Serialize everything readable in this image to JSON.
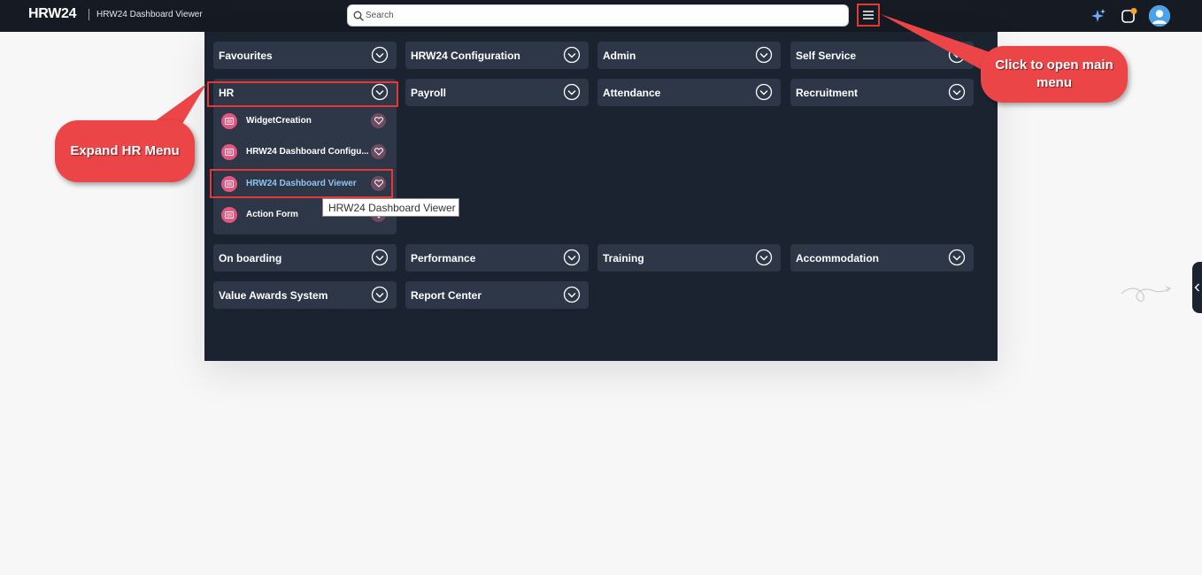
{
  "header": {
    "logo": "HRW24",
    "page_title": "HRW24 Dashboard Viewer",
    "search_placeholder": "Search"
  },
  "menu": {
    "rows": [
      [
        {
          "label": "Favourites"
        },
        {
          "label": "HRW24 Configuration"
        },
        {
          "label": "Admin"
        },
        {
          "label": "Self Service"
        }
      ],
      [
        {
          "label": "HR"
        },
        {
          "label": "Payroll"
        },
        {
          "label": "Attendance"
        },
        {
          "label": "Recruitment"
        }
      ],
      [
        {
          "label": "On boarding"
        },
        {
          "label": "Performance"
        },
        {
          "label": "Training"
        },
        {
          "label": "Accommodation"
        }
      ],
      [
        {
          "label": "Value Awards System"
        },
        {
          "label": "Report Center"
        }
      ]
    ],
    "hr_submenu": [
      {
        "label": "WidgetCreation"
      },
      {
        "label": "HRW24 Dashboard Configu..."
      },
      {
        "label": "HRW24 Dashboard Viewer"
      },
      {
        "label": "Action Form"
      }
    ],
    "tooltip": "HRW24 Dashboard Viewer"
  },
  "annotations": {
    "expand_hr": "Expand HR Menu",
    "open_main_menu": "Click to open main menu"
  },
  "colors": {
    "topbar": "#151a23",
    "panel": "#1c2330",
    "tile": "#2d3748",
    "highlight": "#e53935",
    "callout": "#ec4548",
    "sub_icon": "#e2577f",
    "active_link": "#8fc4f0"
  }
}
